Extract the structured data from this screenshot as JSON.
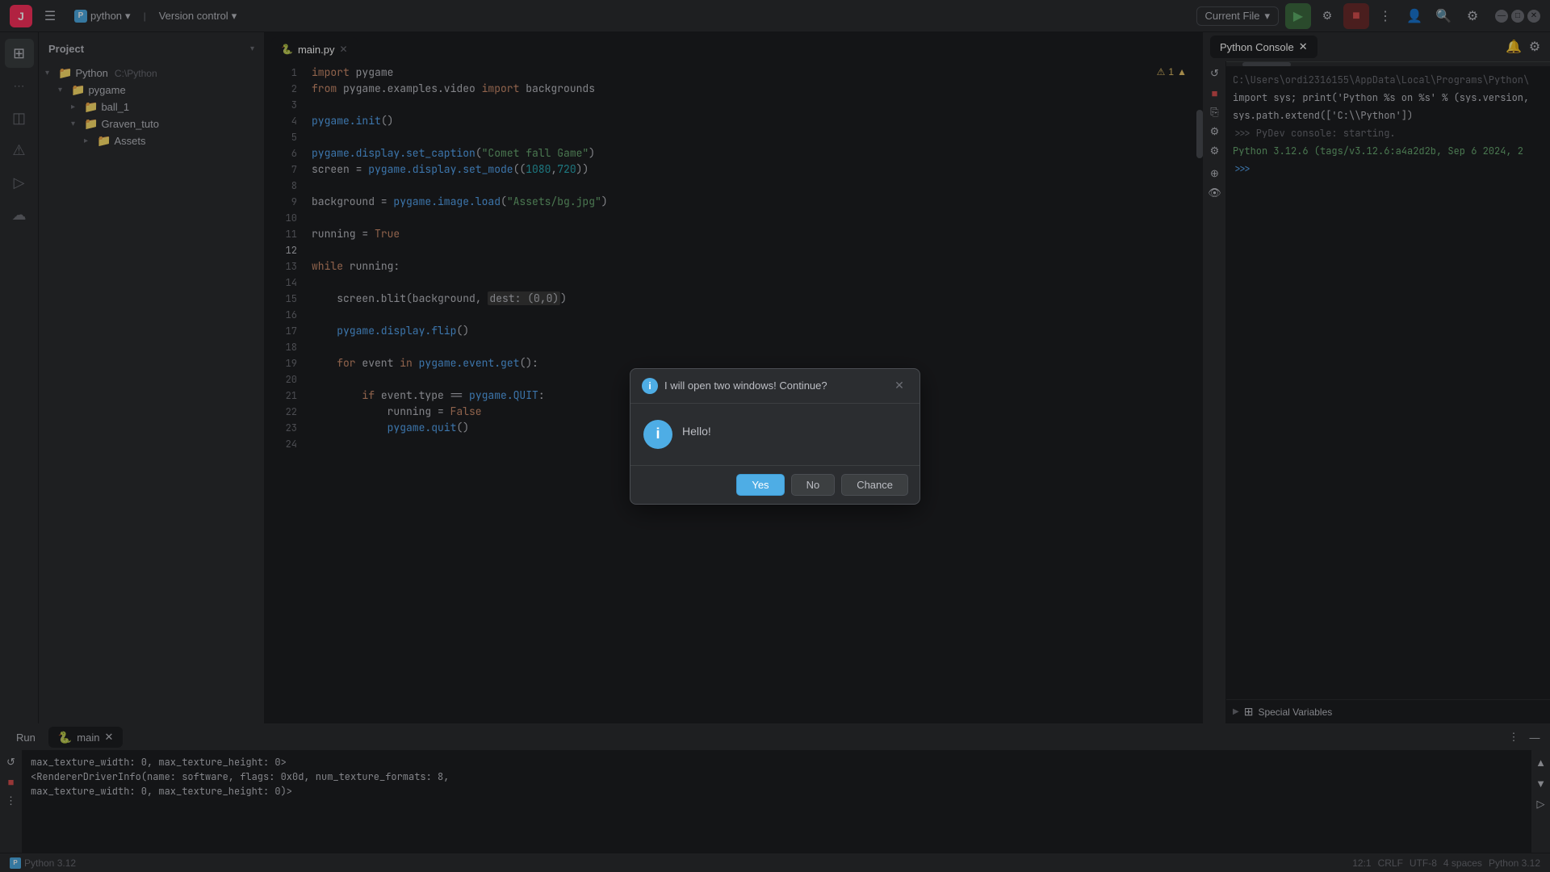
{
  "titlebar": {
    "logo": "J",
    "menu_icon": "☰",
    "project_icon": "P",
    "project_label": "python",
    "chevron_down": "▾",
    "vcs_label": "Version control",
    "vcs_chevron": "▾",
    "run_config_label": "Current File",
    "run_config_chevron": "▾",
    "icon_run": "▶",
    "icon_debug": "🐞",
    "icon_stop": "■",
    "icon_more": "⋮",
    "icon_account": "👤",
    "icon_search": "🔍",
    "icon_settings": "⚙",
    "win_minimize": "—",
    "win_maximize": "□",
    "win_close": "✕"
  },
  "activity_bar": {
    "icons": [
      "⊞",
      "⋯",
      "☰",
      "◫",
      "⚠",
      "⎷",
      "☁"
    ]
  },
  "left_panel": {
    "title": "Project",
    "chevron": "▾",
    "tree": [
      {
        "indent": 0,
        "type": "folder",
        "chevron": "▾",
        "name": "Python",
        "path": "C:\\Python",
        "expanded": true
      },
      {
        "indent": 1,
        "type": "folder",
        "chevron": "▾",
        "name": "pygame",
        "expanded": true
      },
      {
        "indent": 2,
        "type": "folder",
        "chevron": "▸",
        "name": "ball_1",
        "expanded": false
      },
      {
        "indent": 2,
        "type": "folder",
        "chevron": "▾",
        "name": "Graven_tuto",
        "expanded": true
      },
      {
        "indent": 3,
        "type": "folder",
        "chevron": "▸",
        "name": "Assets",
        "expanded": false
      }
    ]
  },
  "editor": {
    "tab_name": "main.py",
    "tab_close": "✕",
    "warning_count": "⚠1",
    "lines": [
      {
        "num": 1,
        "tokens": [
          {
            "cls": "kw",
            "t": "import"
          },
          {
            "cls": "nm",
            "t": " pygame"
          }
        ]
      },
      {
        "num": 2,
        "tokens": [
          {
            "cls": "kw",
            "t": "from"
          },
          {
            "cls": "nm",
            "t": " pygame.examples.video "
          },
          {
            "cls": "kw",
            "t": "import"
          },
          {
            "cls": "nm",
            "t": " backgrounds"
          }
        ]
      },
      {
        "num": 3,
        "tokens": []
      },
      {
        "num": 4,
        "tokens": [
          {
            "cls": "fn",
            "t": "pygame.init"
          },
          {
            "cls": "nm",
            "t": "()"
          }
        ]
      },
      {
        "num": 5,
        "tokens": []
      },
      {
        "num": 6,
        "tokens": [
          {
            "cls": "fn",
            "t": "pygame.display.set_caption"
          },
          {
            "cls": "nm",
            "t": "("
          },
          {
            "cls": "st",
            "t": "\"Comet fall Game\""
          },
          {
            "cls": "nm",
            "t": ")"
          }
        ]
      },
      {
        "num": 7,
        "tokens": [
          {
            "cls": "nm",
            "t": "screen = "
          },
          {
            "cls": "fn",
            "t": "pygame.display.set_mode"
          },
          {
            "cls": "nm",
            "t": "(("
          },
          {
            "cls": "num",
            "t": "1080"
          },
          {
            "cls": "nm",
            "t": ","
          },
          {
            "cls": "num",
            "t": "720"
          },
          {
            "cls": "nm",
            "t": "))"
          }
        ]
      },
      {
        "num": 8,
        "tokens": []
      },
      {
        "num": 9,
        "tokens": [
          {
            "cls": "nm",
            "t": "background = "
          },
          {
            "cls": "fn",
            "t": "pygame.image.load"
          },
          {
            "cls": "nm",
            "t": "("
          },
          {
            "cls": "st",
            "t": "\"Assets/bg.jpg\""
          },
          {
            "cls": "nm",
            "t": ")"
          }
        ]
      },
      {
        "num": 10,
        "tokens": []
      },
      {
        "num": 11,
        "tokens": [
          {
            "cls": "nm",
            "t": "running = "
          },
          {
            "cls": "kw",
            "t": "True"
          }
        ]
      },
      {
        "num": 12,
        "tokens": []
      },
      {
        "num": 13,
        "tokens": [
          {
            "cls": "kw",
            "t": "while"
          },
          {
            "cls": "nm",
            "t": " running:"
          }
        ]
      },
      {
        "num": 14,
        "tokens": []
      },
      {
        "num": 15,
        "tokens": [
          {
            "cls": "nm",
            "t": "    screen.blit(background, "
          },
          {
            "cls": "highlight",
            "t": "dest: (0,0)"
          },
          {
            "cls": "nm",
            "t": ")"
          }
        ]
      },
      {
        "num": 16,
        "tokens": []
      },
      {
        "num": 17,
        "tokens": [
          {
            "cls": "fn",
            "t": "    pygame.display.flip"
          },
          {
            "cls": "nm",
            "t": "()"
          }
        ]
      },
      {
        "num": 18,
        "tokens": []
      },
      {
        "num": 19,
        "tokens": [
          {
            "cls": "kw",
            "t": "    for"
          },
          {
            "cls": "nm",
            "t": " event "
          },
          {
            "cls": "kw",
            "t": "in"
          },
          {
            "cls": "fn",
            "t": " pygame.event.get"
          },
          {
            "cls": "nm",
            "t": "():"
          }
        ]
      },
      {
        "num": 20,
        "tokens": []
      },
      {
        "num": 21,
        "tokens": [
          {
            "cls": "kw",
            "t": "        if"
          },
          {
            "cls": "nm",
            "t": " event.type == "
          },
          {
            "cls": "fn",
            "t": "pygame.QUIT"
          },
          {
            "cls": "nm",
            "t": ":"
          }
        ]
      },
      {
        "num": 22,
        "tokens": [
          {
            "cls": "nm",
            "t": "            running = "
          },
          {
            "cls": "kw",
            "t": "False"
          }
        ]
      },
      {
        "num": 23,
        "tokens": [
          {
            "cls": "fn",
            "t": "            pygame.quit"
          },
          {
            "cls": "nm",
            "t": "()"
          }
        ]
      },
      {
        "num": 24,
        "tokens": []
      }
    ]
  },
  "python_console": {
    "tab_label": "Python Console",
    "tab_close": "✕",
    "path_line": "C:\\Users\\ordi2316155\\AppData\\Local\\Programs\\Python\\",
    "setup_cmd": "import sys; print('Python %s on %s' % (sys.version,",
    "setup_cmd2": "sys.path.extend(['C:\\\\Python'])",
    "pydev_line": "PyDev console: starting.",
    "python_info": "Python 3.12.6 (tags/v3.12.6:a4a2d2b, Sep  6 2024, 2",
    "prompt": ">>>"
  },
  "special_variables": {
    "chevron": "▶",
    "icon": "⊞",
    "label": "Special Variables"
  },
  "bottom_panel": {
    "run_tab": "Run",
    "run_tab_icon": "▶",
    "main_tab": "main",
    "main_tab_icon": "🐍",
    "main_tab_close": "✕",
    "more_icon": "⋮",
    "minimize_icon": "—",
    "run_output": [
      "max_texture_width: 0, max_texture_height: 0>",
      "<RendererDriverInfo(name: software, flags: 0x0d, num_texture_formats: 8,",
      "    max_texture_width: 0, max_texture_height: 0)>"
    ]
  },
  "status_bar": {
    "line_col": "12:1",
    "crlf": "CRLF",
    "encoding": "UTF-8",
    "indent": "4 spaces",
    "python_version": "Python 3.12",
    "python_icon": "P"
  },
  "modal": {
    "title": "I will open two windows! Continue?",
    "close_icon": "✕",
    "info_icon": "i",
    "message": "Hello!",
    "btn_yes": "Yes",
    "btn_no": "No",
    "btn_chance": "Chance"
  }
}
